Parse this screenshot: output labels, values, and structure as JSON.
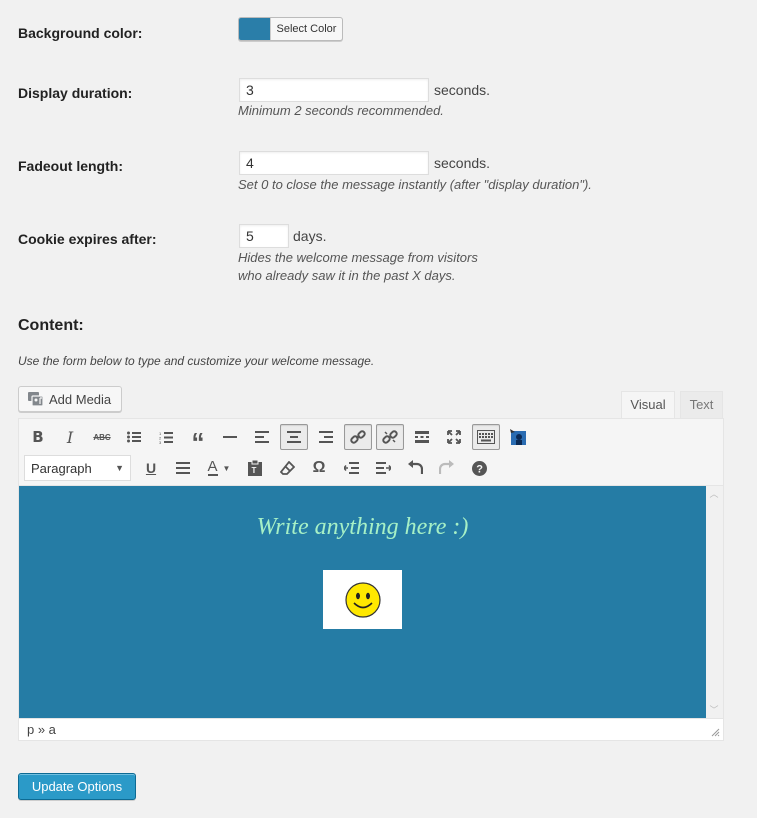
{
  "settings": {
    "background_color": {
      "label": "Background color:",
      "button_label": "Select Color",
      "swatch_color": "#2a7ea9"
    },
    "display_duration": {
      "label": "Display duration:",
      "value": "3",
      "suffix": "seconds.",
      "description": "Minimum 2 seconds recommended."
    },
    "fadeout_length": {
      "label": "Fadeout length:",
      "value": "4",
      "suffix": "seconds.",
      "description": "Set 0 to close the message instantly (after \"display duration\")."
    },
    "cookie_expires": {
      "label": "Cookie expires after:",
      "value": "5",
      "suffix": "days.",
      "description_line1": "Hides the welcome message from visitors",
      "description_line2": "who already saw it in the past X days."
    }
  },
  "content_section": {
    "title": "Content:",
    "description": "Use the form below to type and customize your welcome message."
  },
  "editor": {
    "add_media_label": "Add Media",
    "tabs": [
      {
        "label": "Visual",
        "active": true
      },
      {
        "label": "Text",
        "active": false
      }
    ],
    "toolbar_row1": [
      "bold-icon",
      "italic-icon",
      "strikethrough-icon",
      "bullet-list-icon",
      "numbered-list-icon",
      "blockquote-icon",
      "horizontal-rule-icon",
      "align-left-icon",
      "align-center-icon",
      "align-right-icon",
      "link-icon",
      "unlink-icon",
      "read-more-icon",
      "fullscreen-icon",
      "toolbar-toggle-icon",
      "wp-smiley-plugin-icon"
    ],
    "toolbar_row2": [
      "underline-icon",
      "justify-icon",
      "text-color-icon",
      "paste-text-icon",
      "clear-formatting-icon",
      "special-character-icon",
      "outdent-icon",
      "indent-icon",
      "undo-icon",
      "redo-icon",
      "help-icon"
    ],
    "format_select": "Paragraph",
    "content_background": "#257ca5",
    "content_heading": "Write anything here :)",
    "content_heading_color": "#a6f0c6",
    "path": "p » a"
  },
  "submit_label": "Update Options"
}
